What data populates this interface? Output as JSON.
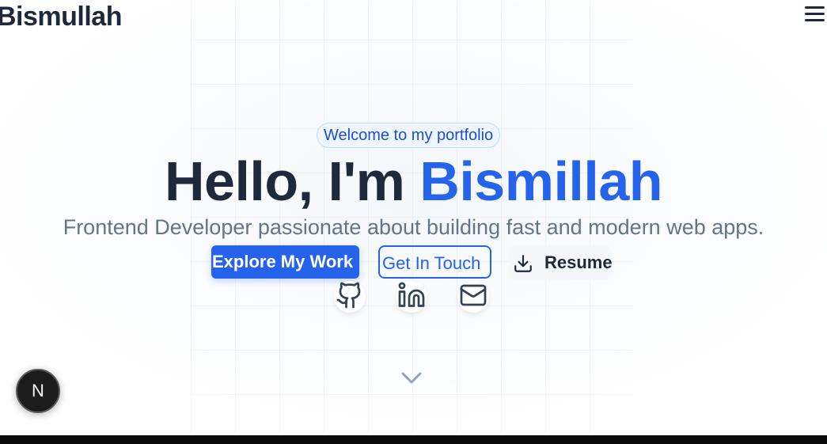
{
  "nav": {
    "brand": "Bismullah",
    "menu_icon": "menu-icon"
  },
  "hero": {
    "badge": "Welcome to my portfolio",
    "greeting": "Hello, I'm",
    "name": "Bismillah",
    "subtitle": "Frontend Developer passionate about building fast and modern web apps.",
    "buttons": {
      "explore": "Explore My Work",
      "contact": "Get In Touch",
      "resume": "Resume",
      "resume_icon": "download-icon"
    },
    "social": [
      {
        "icon": "github-icon"
      },
      {
        "icon": "linkedin-icon"
      },
      {
        "icon": "mail-icon"
      }
    ],
    "scroll_icon": "chevron-down-icon"
  },
  "dev_indicator": {
    "label": "N"
  },
  "colors": {
    "accent": "#2563eb",
    "text_dark": "#1e293b",
    "text_muted": "#64748b",
    "icon": "#334155"
  }
}
